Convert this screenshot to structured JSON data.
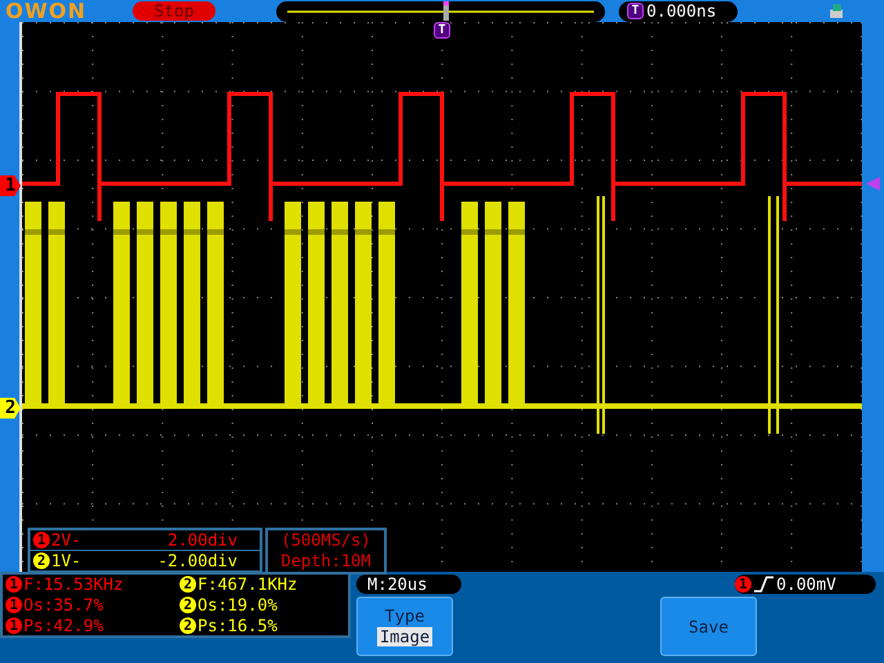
{
  "header": {
    "logo": "OWON",
    "status": "Stop",
    "trigger_marker": "T",
    "trigger_time": "0.000ns"
  },
  "plot_trigger_marker": "T",
  "channels": [
    {
      "label": "1",
      "badge": "1",
      "color": "#ff0000",
      "scale": "2V-",
      "offset": "2.00div"
    },
    {
      "label": "2",
      "badge": "2",
      "color": "#ffff00",
      "scale": "1V-",
      "offset": "-2.00div"
    }
  ],
  "acquisition": {
    "rate": "(500MS/s)",
    "depth": "Depth:10M"
  },
  "measurements": [
    {
      "channel": "1",
      "color": "#ff0000",
      "text": "F:15.53KHz"
    },
    {
      "channel": "2",
      "color": "#ffff00",
      "text": "F:467.1KHz"
    },
    {
      "channel": "1",
      "color": "#ff0000",
      "text": "Os:35.7%"
    },
    {
      "channel": "2",
      "color": "#ffff00",
      "text": "Os:19.0%"
    },
    {
      "channel": "1",
      "color": "#ff0000",
      "text": "Ps:42.9%"
    },
    {
      "channel": "2",
      "color": "#ffff00",
      "text": "Ps:16.5%"
    }
  ],
  "timebase": "M:20us",
  "trigger_level": {
    "channel": "1",
    "color": "#ff0000",
    "value": "0.00mV"
  },
  "menu": [
    {
      "kind": "option",
      "label": "Type",
      "value": "Image"
    },
    {
      "kind": "action",
      "label": "Save"
    }
  ]
}
